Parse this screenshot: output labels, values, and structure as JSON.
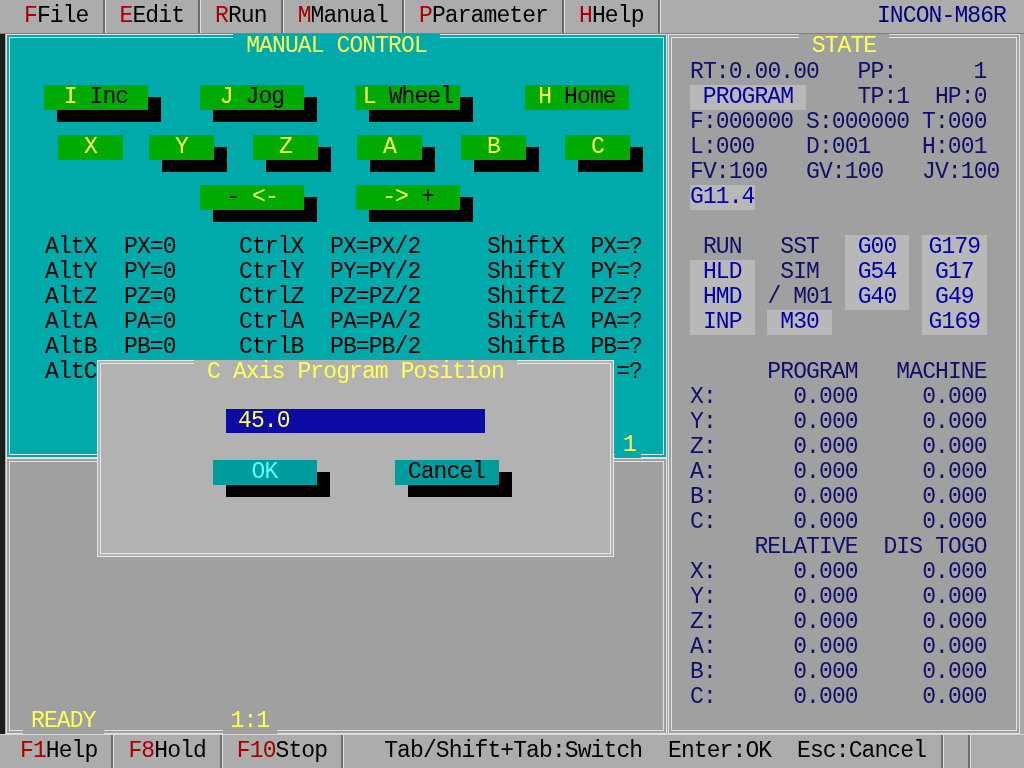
{
  "menu_bar": {
    "items": [
      {
        "key": "F",
        "label": "File"
      },
      {
        "key": "E",
        "label": "Edit"
      },
      {
        "key": "R",
        "label": "Run"
      },
      {
        "key": "M",
        "label": "Manual"
      },
      {
        "key": "P",
        "label": "Parameter"
      },
      {
        "key": "H",
        "label": "Help"
      }
    ],
    "product": "INCON-M86R"
  },
  "manual_control": {
    "title": "MANUAL CONTROL",
    "mode_buttons": [
      {
        "segments": [
          {
            "text": "I",
            "hotkey": true
          },
          {
            "text": "Inc",
            "hotkey": false
          }
        ],
        "pressed": false
      },
      {
        "segments": [
          {
            "text": "J",
            "hotkey": true
          },
          {
            "text": "Jog",
            "hotkey": false
          }
        ],
        "pressed": false
      },
      {
        "segments": [
          {
            "text": "L",
            "hotkey": true
          },
          {
            "text": "Wheel",
            "hotkey": false
          }
        ],
        "pressed": false
      },
      {
        "segments": [
          {
            "text": "H",
            "hotkey": true
          },
          {
            "text": "Home",
            "hotkey": false
          }
        ],
        "pressed": true
      }
    ],
    "axis_buttons": [
      {
        "segments": [
          {
            "text": "X",
            "hotkey": true
          }
        ],
        "pressed": true
      },
      {
        "segments": [
          {
            "text": "Y",
            "hotkey": true
          }
        ],
        "pressed": false
      },
      {
        "segments": [
          {
            "text": "Z",
            "hotkey": true
          }
        ],
        "pressed": false
      },
      {
        "segments": [
          {
            "text": "A",
            "hotkey": true
          }
        ],
        "pressed": false
      },
      {
        "segments": [
          {
            "text": "B",
            "hotkey": true
          }
        ],
        "pressed": false
      },
      {
        "segments": [
          {
            "text": "C",
            "hotkey": true
          }
        ],
        "pressed": false
      }
    ],
    "direction_buttons": [
      {
        "segments": [
          {
            "text": "-",
            "hotkey": false
          },
          {
            "text": "<-",
            "hotkey": true
          }
        ],
        "pressed": false
      },
      {
        "segments": [
          {
            "text": "->",
            "hotkey": true
          },
          {
            "text": "+",
            "hotkey": false
          }
        ],
        "pressed": false
      }
    ],
    "shortcuts": [
      {
        "alt_key": "AltX",
        "alt_action": "PX=0",
        "ctrl_key": "CtrlX",
        "ctrl_action": "PX=PX/2",
        "shift_key": "ShiftX",
        "shift_action": "PX=?"
      },
      {
        "alt_key": "AltY",
        "alt_action": "PY=0",
        "ctrl_key": "CtrlY",
        "ctrl_action": "PY=PY/2",
        "shift_key": "ShiftY",
        "shift_action": "PY=?"
      },
      {
        "alt_key": "AltZ",
        "alt_action": "PZ=0",
        "ctrl_key": "CtrlZ",
        "ctrl_action": "PZ=PZ/2",
        "shift_key": "ShiftZ",
        "shift_action": "PZ=?"
      },
      {
        "alt_key": "AltA",
        "alt_action": "PA=0",
        "ctrl_key": "CtrlA",
        "ctrl_action": "PA=PA/2",
        "shift_key": "ShiftA",
        "shift_action": "PA=?"
      },
      {
        "alt_key": "AltB",
        "alt_action": "PB=0",
        "ctrl_key": "CtrlB",
        "ctrl_action": "PB=PB/2",
        "shift_key": "ShiftB",
        "shift_action": "PB=?"
      },
      {
        "alt_key": "AltC",
        "shift_action": "=?"
      }
    ],
    "border_label": "1"
  },
  "dialog": {
    "title": "C Axis Program Position",
    "input": {
      "value": "45.0"
    },
    "buttons": [
      {
        "label": "OK",
        "focused": true
      },
      {
        "label": "Cancel",
        "focused": false
      }
    ]
  },
  "message_panel": {
    "labels": [
      "READY",
      "1:1"
    ]
  },
  "state": {
    "title": "STATE",
    "readouts": [
      [
        {
          "text": "RT:0.00.00",
          "highlighted": false
        },
        {
          "text": "PP:",
          "highlighted": false
        },
        {
          "text": "1",
          "highlighted": false
        }
      ],
      [
        {
          "text": "PROGRAM",
          "highlighted": true
        },
        {
          "text": "TP:1",
          "highlighted": false
        },
        {
          "text": "HP:0",
          "highlighted": false
        }
      ],
      [
        {
          "text": "F:000000",
          "highlighted": false
        },
        {
          "text": "S:000000",
          "highlighted": false
        },
        {
          "text": "T:000",
          "highlighted": false
        }
      ],
      [
        {
          "text": "L:000",
          "highlighted": false
        },
        {
          "text": "D:001",
          "highlighted": false
        },
        {
          "text": "H:001",
          "highlighted": false
        }
      ],
      [
        {
          "text": "FV:100",
          "highlighted": false
        },
        {
          "text": "GV:100",
          "highlighted": false
        },
        {
          "text": "JV:100",
          "highlighted": false
        }
      ],
      [
        {
          "text": "G11.4",
          "highlighted": true
        }
      ]
    ],
    "flags": [
      [
        {
          "text": "RUN",
          "highlighted": false
        },
        {
          "text": "HLD",
          "highlighted": true
        },
        {
          "text": "HMD",
          "highlighted": true
        },
        {
          "text": "INP",
          "highlighted": true
        }
      ],
      [
        {
          "text": "SST",
          "highlighted": false
        },
        {
          "text": "SIM",
          "highlighted": false
        },
        {
          "text": "/ M01",
          "highlighted": false
        },
        {
          "text": "M30",
          "highlighted": true
        }
      ],
      [
        {
          "text": "G00",
          "highlighted": true
        },
        {
          "text": "G54",
          "highlighted": true
        },
        {
          "text": "G40",
          "highlighted": true
        }
      ],
      [
        {
          "text": "G179",
          "highlighted": true
        },
        {
          "text": "G17",
          "highlighted": true
        },
        {
          "text": "G49",
          "highlighted": true
        },
        {
          "text": "G169",
          "highlighted": true
        }
      ]
    ],
    "positions": [
      {
        "headers": [
          "PROGRAM",
          "MACHINE"
        ],
        "rows": [
          {
            "axis": "X:",
            "values": [
              "0.000",
              "0.000"
            ]
          },
          {
            "axis": "Y:",
            "values": [
              "0.000",
              "0.000"
            ]
          },
          {
            "axis": "Z:",
            "values": [
              "0.000",
              "0.000"
            ]
          },
          {
            "axis": "A:",
            "values": [
              "0.000",
              "0.000"
            ]
          },
          {
            "axis": "B:",
            "values": [
              "0.000",
              "0.000"
            ]
          },
          {
            "axis": "C:",
            "values": [
              "0.000",
              "0.000"
            ]
          }
        ]
      },
      {
        "headers": [
          "RELATIVE",
          "DIS TOGO"
        ],
        "rows": [
          {
            "axis": "X:",
            "values": [
              "0.000",
              "0.000"
            ]
          },
          {
            "axis": "Y:",
            "values": [
              "0.000",
              "0.000"
            ]
          },
          {
            "axis": "Z:",
            "values": [
              "0.000",
              "0.000"
            ]
          },
          {
            "axis": "A:",
            "values": [
              "0.000",
              "0.000"
            ]
          },
          {
            "axis": "B:",
            "values": [
              "0.000",
              "0.000"
            ]
          },
          {
            "axis": "C:",
            "values": [
              "0.000",
              "0.000"
            ]
          }
        ]
      }
    ]
  },
  "function_bar": {
    "keys": [
      {
        "key": "F1",
        "label": "Help"
      },
      {
        "key": "F8",
        "label": "Hold"
      },
      {
        "key": "F10",
        "label": "Stop"
      }
    ],
    "hints": [
      "Tab/Shift+Tab:Switch",
      "Enter:OK",
      "Esc:Cancel"
    ]
  }
}
